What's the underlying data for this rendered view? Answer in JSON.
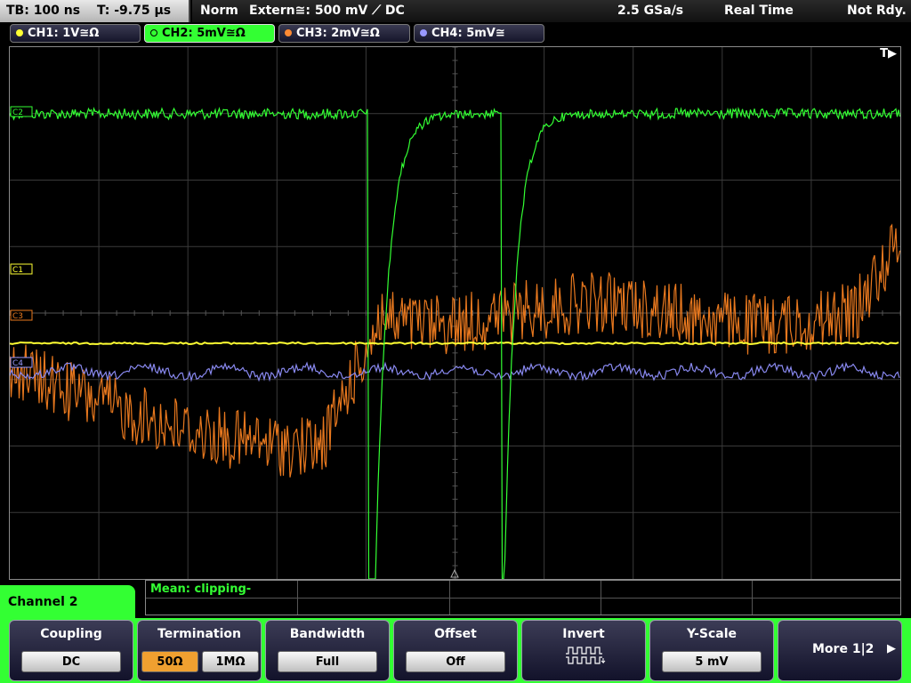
{
  "status": {
    "timebase": "TB: 100 ns",
    "trigger_time": "T: -9.75 µs",
    "mode": "Norm",
    "trigger_source": "Extern≅: 500 mV ⟋ DC",
    "sample_rate": "2.5 GSa/s",
    "acq_mode": "Real Time",
    "ready_state": "Not Rdy."
  },
  "channels": [
    {
      "label": "CH1: 1V≅Ω",
      "color": "#ffff33",
      "active": false
    },
    {
      "label": "CH2: 5mV≅Ω",
      "color": "#33ff33",
      "active": true
    },
    {
      "label": "CH3: 2mV≅Ω",
      "color": "#ff8a33",
      "active": false
    },
    {
      "label": "CH4: 5mV≅",
      "color": "#9898ff",
      "active": false
    }
  ],
  "markers": {
    "c1": "C1",
    "c2": "C2",
    "c3": "C3",
    "c4": "C4",
    "trigger": "T▶"
  },
  "measurement": {
    "text": "Mean: clipping-"
  },
  "menu": {
    "title": "Channel 2",
    "coupling_title": "Coupling",
    "coupling_value": "DC",
    "termination_title": "Termination",
    "termination_50": "50Ω",
    "termination_1m": "1MΩ",
    "bandwidth_title": "Bandwidth",
    "bandwidth_value": "Full",
    "offset_title": "Offset",
    "offset_value": "Off",
    "invert_title": "Invert",
    "yscale_title": "Y-Scale",
    "yscale_value": "5 mV",
    "more_label": "More 1|2"
  },
  "colors": {
    "ch1": "#ffff33",
    "ch2": "#33ff33",
    "ch3": "#e8781e",
    "ch4": "#8888ee",
    "grid": "#3a3a3a",
    "termination_selected": "#f0a030"
  }
}
